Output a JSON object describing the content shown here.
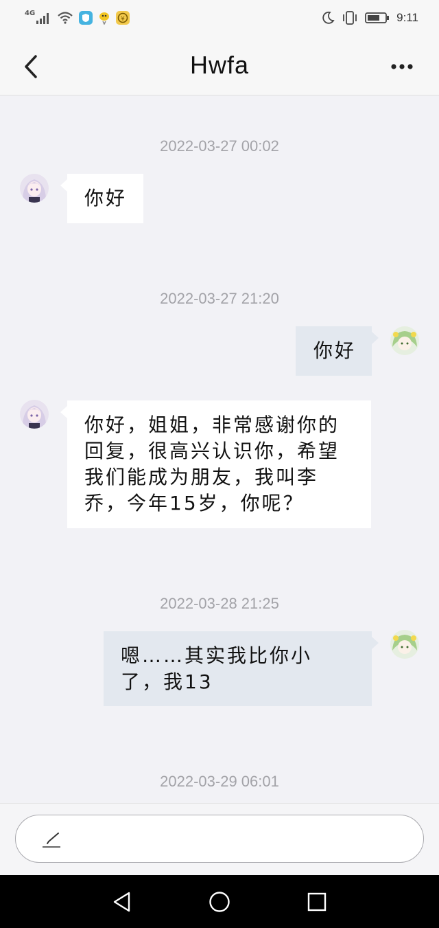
{
  "status_bar": {
    "network": "4G",
    "time": "9:11",
    "icons": [
      "signal-icon",
      "wifi-icon",
      "app-notification-icon",
      "bird-notification-icon",
      "coin-notification-icon",
      "moon-icon",
      "vibrate-icon",
      "battery-icon"
    ]
  },
  "header": {
    "title": "Hwfa",
    "back_icon": "chevron-left-icon",
    "more_icon": "more-dots-icon"
  },
  "messages": [
    {
      "type": "timestamp",
      "text": "2022-03-27 00:02"
    },
    {
      "type": "message",
      "direction": "incoming",
      "text": "你好"
    },
    {
      "type": "timestamp",
      "text": "2022-03-27 21:20"
    },
    {
      "type": "message",
      "direction": "outgoing",
      "text": "你好"
    },
    {
      "type": "message",
      "direction": "incoming",
      "lines": [
        "你好，姐姐，非常感谢你的",
        "回复，很高兴认识你，希望",
        "我们能成为朋友，我叫李",
        "乔，今年15岁，你呢？"
      ]
    },
    {
      "type": "timestamp",
      "text": "2022-03-28 21:25"
    },
    {
      "type": "message",
      "direction": "outgoing",
      "lines": [
        "嗯……其实我比你小",
        "了，我13"
      ]
    },
    {
      "type": "timestamp",
      "text": "2022-03-29 06:01"
    }
  ],
  "input": {
    "placeholder": "",
    "icon": "pencil-icon"
  },
  "nav_bar": {
    "icons": [
      "back-triangle-icon",
      "home-circle-icon",
      "recents-square-icon"
    ]
  },
  "colors": {
    "background": "#f2f2f6",
    "incoming_bubble": "#ffffff",
    "outgoing_bubble": "#e3e8ef",
    "timestamp": "#a3a3a8"
  }
}
